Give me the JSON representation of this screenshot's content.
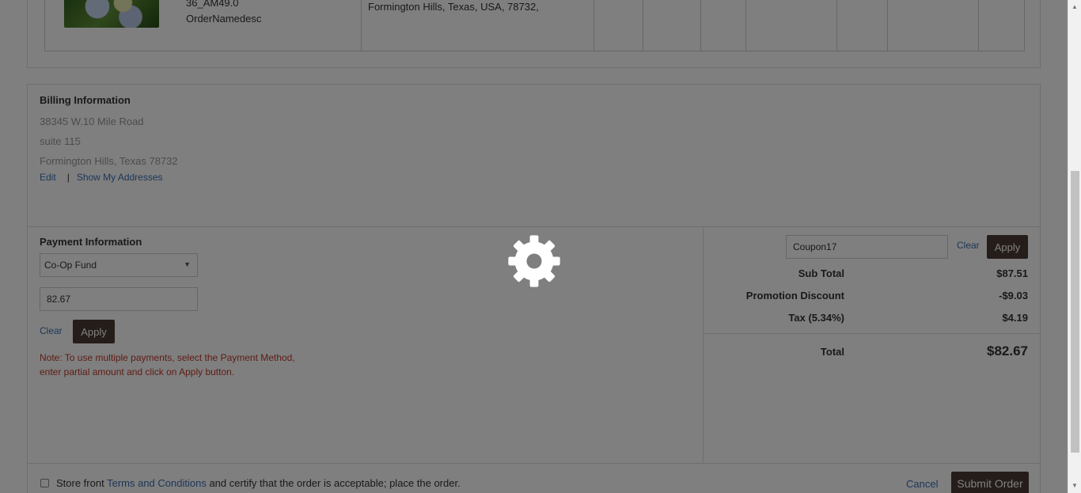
{
  "order_item": {
    "sku": "36_AM49.0",
    "name": "OrderNamedesc",
    "shipping_address": "Formington Hills, Texas, USA, 78732,"
  },
  "billing": {
    "title": "Billing Information",
    "address_line1": "38345 W.10 Mile Road",
    "address_line2": "suite 115",
    "address_line3": "Formington Hills, Texas 78732",
    "edit_label": "Edit",
    "separator": "|",
    "show_addresses_label": "Show My Addresses"
  },
  "payment": {
    "title": "Payment Information",
    "method_selected": "Co-Op Fund",
    "amount_value": "82.67",
    "clear_label": "Clear",
    "apply_label": "Apply",
    "note": "Note: To use multiple payments, select the Payment Method, enter partial amount and click on Apply button."
  },
  "summary": {
    "coupon_value": "Coupon17",
    "clear_label": "Clear",
    "apply_label": "Apply",
    "sub_total_label": "Sub Total",
    "sub_total_value": "$87.51",
    "promotion_label": "Promotion Discount",
    "promotion_value": "-$9.03",
    "tax_label": "Tax (5.34%)",
    "tax_value": "$4.19",
    "total_label": "Total",
    "total_value": "$82.67"
  },
  "footer": {
    "terms_prefix": "Store front",
    "terms_link": "Terms and Conditions",
    "terms_suffix": "and certify that the order is acceptable; place the order.",
    "cancel_label": "Cancel",
    "submit_label": "Submit Order"
  },
  "icons": {
    "loading": "gear-icon",
    "scroll_up": "triangle-up",
    "scroll_down": "triangle-down"
  },
  "colors": {
    "link": "#3a6fb0",
    "button": "#4a3a33",
    "note": "#c0392b",
    "overlay": "rgba(0,0,0,0.5)"
  }
}
